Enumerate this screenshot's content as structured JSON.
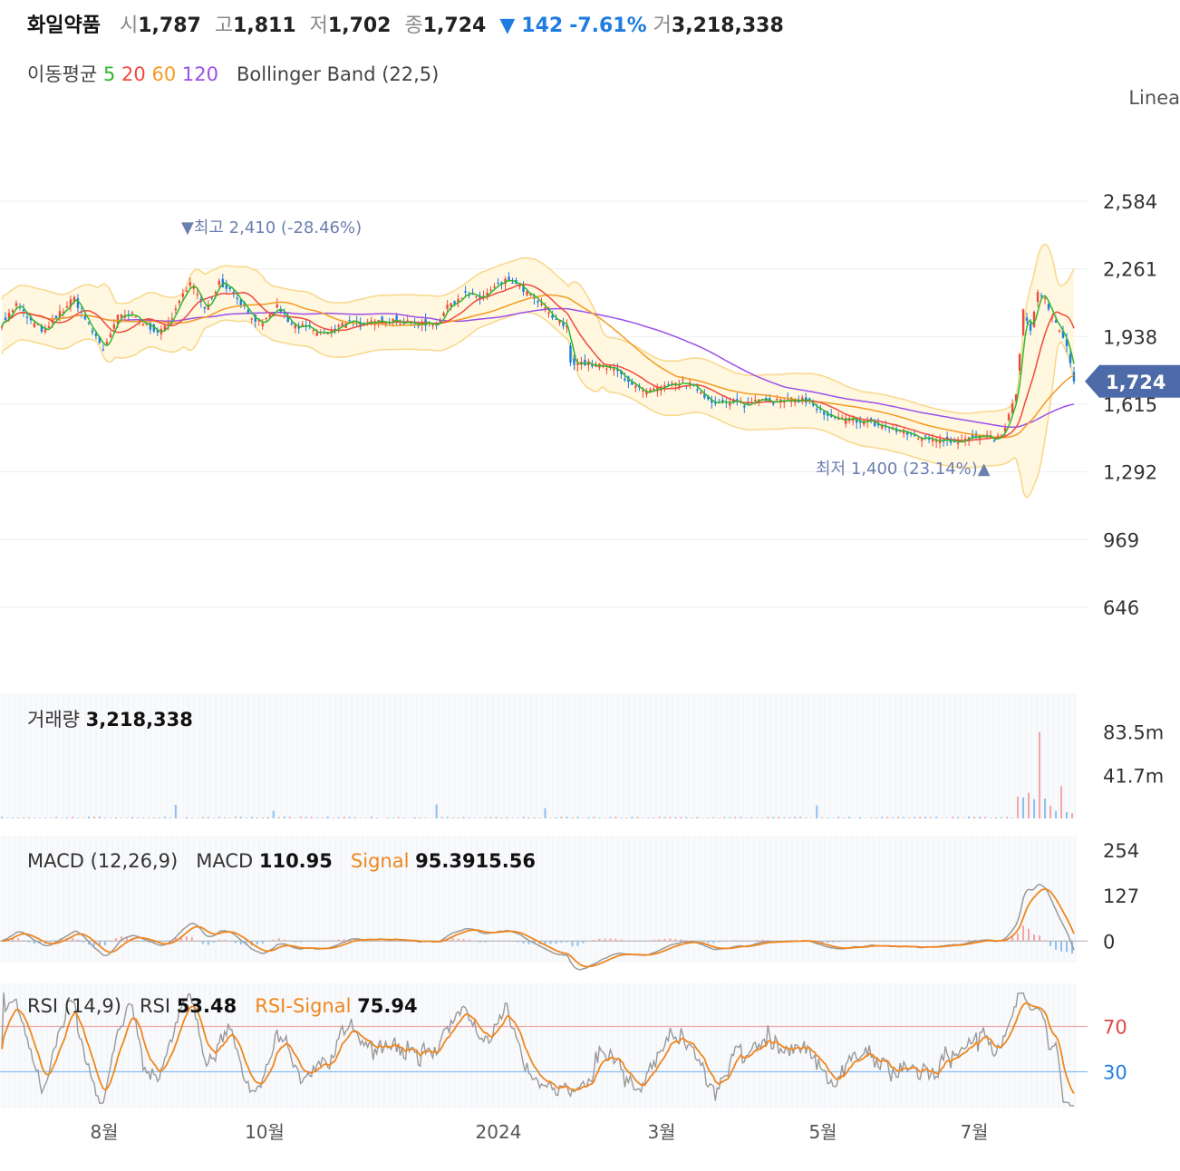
{
  "header": {
    "name": "화일약품",
    "open_label": "시",
    "open": "1,787",
    "high_label": "고",
    "high": "1,811",
    "low_label": "저",
    "low": "1,702",
    "close_label": "종",
    "close": "1,724",
    "change_arrow": "▼",
    "change": "142",
    "change_pct": "-7.61%",
    "volume_label": "거",
    "volume": "3,218,338"
  },
  "indicators": {
    "ma_label": "이동평균",
    "ma5": "5",
    "ma20": "20",
    "ma60": "60",
    "ma120": "120",
    "bollinger": "Bollinger Band (22,5)"
  },
  "scale_mode": "Linea",
  "colors": {
    "up": "#ef4b3c",
    "down": "#1f7ce0",
    "ma5": "#2eb82e",
    "ma20": "#ef4b3c",
    "ma60": "#f59a23",
    "ma120": "#9b50e8",
    "band_fill": "#fff7e0",
    "band_line": "#f8d78a",
    "price_tag": "#4d6ba8",
    "macd": "#999999",
    "signal": "#f0861f",
    "rsi_over": "#f4a6a6",
    "rsi_under": "#8cc0ef"
  },
  "annotations": {
    "high": "▼최고 2,410 (-28.46%)",
    "low": "최저 1,400 (23.14%)▲"
  },
  "price_axis": {
    "ticks": [
      "2,584",
      "2,261",
      "1,938",
      "1,615",
      "1,292",
      "969",
      "646"
    ],
    "current_tag": "1,724"
  },
  "volume_panel": {
    "title": "거래량",
    "value": "3,218,338",
    "ticks": [
      "83.5m",
      "41.7m"
    ]
  },
  "macd_panel": {
    "title": "MACD (12,26,9)",
    "macd_label": "MACD",
    "macd_value": "110.95",
    "signal_label": "Signal",
    "signal_value": "95.3915.56",
    "ticks": [
      "254",
      "127",
      "0"
    ]
  },
  "rsi_panel": {
    "title": "RSI (14,9)",
    "rsi_label": "RSI",
    "rsi_value": "53.48",
    "signal_label": "RSI-Signal",
    "signal_value": "75.94",
    "ticks": [
      "70",
      "30"
    ]
  },
  "x_axis": {
    "labels": [
      "8월",
      "10월",
      "2024",
      "3월",
      "5월",
      "7월"
    ]
  },
  "chart_data": {
    "type": "candlestick",
    "price_ylim": [
      500,
      2750
    ],
    "price_ticks": [
      2584,
      2261,
      1938,
      1615,
      1292,
      969,
      646
    ],
    "last_close": 1724,
    "period_high": 2410,
    "period_low": 1400,
    "close_path": [
      [
        0,
        2000
      ],
      [
        8,
        2090
      ],
      [
        16,
        2010
      ],
      [
        24,
        1960
      ],
      [
        32,
        2050
      ],
      [
        40,
        2120
      ],
      [
        48,
        1990
      ],
      [
        56,
        1880
      ],
      [
        64,
        2030
      ],
      [
        72,
        2040
      ],
      [
        80,
        1990
      ],
      [
        88,
        1960
      ],
      [
        96,
        2060
      ],
      [
        104,
        2210
      ],
      [
        112,
        2060
      ],
      [
        120,
        2200
      ],
      [
        128,
        2150
      ],
      [
        136,
        2050
      ],
      [
        144,
        1990
      ],
      [
        152,
        2080
      ],
      [
        160,
        1990
      ],
      [
        168,
        1980
      ],
      [
        176,
        1950
      ],
      [
        184,
        1970
      ],
      [
        192,
        2020
      ],
      [
        200,
        1990
      ],
      [
        208,
        2010
      ],
      [
        216,
        2020
      ],
      [
        224,
        2000
      ],
      [
        232,
        2000
      ],
      [
        240,
        2000
      ],
      [
        248,
        2100
      ],
      [
        256,
        2140
      ],
      [
        264,
        2120
      ],
      [
        272,
        2170
      ],
      [
        280,
        2210
      ],
      [
        288,
        2160
      ],
      [
        296,
        2100
      ],
      [
        304,
        2030
      ],
      [
        312,
        1980
      ],
      [
        314,
        1820
      ],
      [
        322,
        1810
      ],
      [
        330,
        1800
      ],
      [
        338,
        1780
      ],
      [
        346,
        1730
      ],
      [
        354,
        1670
      ],
      [
        360,
        1680
      ],
      [
        368,
        1700
      ],
      [
        376,
        1720
      ],
      [
        384,
        1690
      ],
      [
        390,
        1640
      ],
      [
        398,
        1620
      ],
      [
        406,
        1620
      ],
      [
        412,
        1610
      ],
      [
        418,
        1650
      ],
      [
        426,
        1630
      ],
      [
        434,
        1630
      ],
      [
        442,
        1640
      ],
      [
        448,
        1610
      ],
      [
        456,
        1550
      ],
      [
        464,
        1540
      ],
      [
        472,
        1540
      ],
      [
        478,
        1530
      ],
      [
        486,
        1510
      ],
      [
        494,
        1490
      ],
      [
        502,
        1470
      ],
      [
        510,
        1450
      ],
      [
        518,
        1450
      ],
      [
        526,
        1440
      ],
      [
        534,
        1450
      ],
      [
        540,
        1460
      ],
      [
        548,
        1450
      ],
      [
        552,
        1460
      ],
      [
        556,
        1560
      ],
      [
        560,
        1660
      ],
      [
        564,
        2060
      ],
      [
        568,
        1960
      ],
      [
        572,
        2140
      ],
      [
        576,
        2120
      ],
      [
        580,
        2020
      ],
      [
        584,
        1960
      ],
      [
        588,
        1900
      ],
      [
        592,
        1724
      ]
    ],
    "series": [
      {
        "name": "5",
        "color": "#2eb82e"
      },
      {
        "name": "20",
        "color": "#ef4b3c"
      },
      {
        "name": "60",
        "color": "#f59a23"
      },
      {
        "name": "120",
        "color": "#9b50e8"
      }
    ],
    "volume": {
      "ylim": [
        0,
        90
      ],
      "tick_values": [
        83.5,
        41.7
      ],
      "unit": "m",
      "recent_peak": 83.5
    },
    "macd": {
      "ylim": [
        -60,
        254
      ],
      "ticks": [
        254,
        127,
        0
      ],
      "macd": 110.95
    },
    "rsi": {
      "ylim": [
        0,
        100
      ],
      "ticks": [
        70,
        30
      ],
      "rsi": 53.48,
      "signal": 75.94
    }
  }
}
